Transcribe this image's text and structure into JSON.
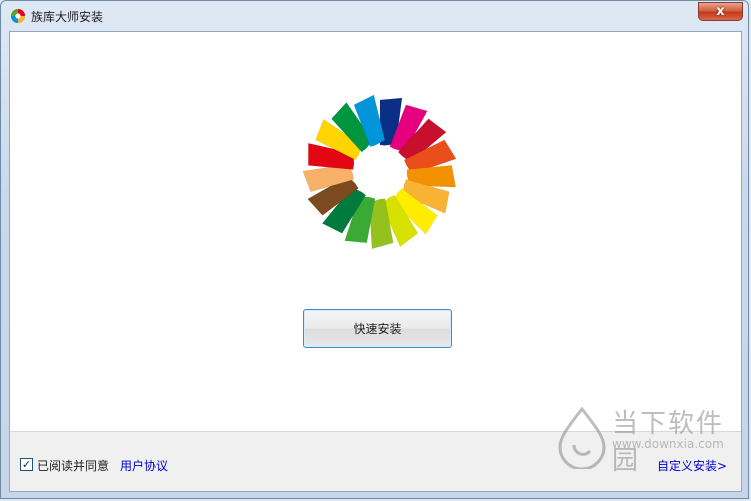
{
  "window": {
    "title": "族库大师安装",
    "close_label": "x"
  },
  "main": {
    "install_button_label": "快速安装"
  },
  "footer": {
    "agree_checked": true,
    "agree_checkmark": "✓",
    "agree_label": "已阅读并同意",
    "agreement_link": "用户协议",
    "custom_install_link": "自定义安装>"
  },
  "watermark": {
    "brand_text": "当下软件园",
    "url_text": "www.downxia.com"
  },
  "logo": {
    "petal_colors": [
      "#0b2f86",
      "#e5007e",
      "#c8102e",
      "#e94e1b",
      "#f39200",
      "#f9b233",
      "#ffed00",
      "#d6e100",
      "#95c11f",
      "#3aaa35",
      "#007a3d",
      "#7b4a1f",
      "#f7b168",
      "#e30613",
      "#ffd500",
      "#009640",
      "#0095db"
    ]
  }
}
